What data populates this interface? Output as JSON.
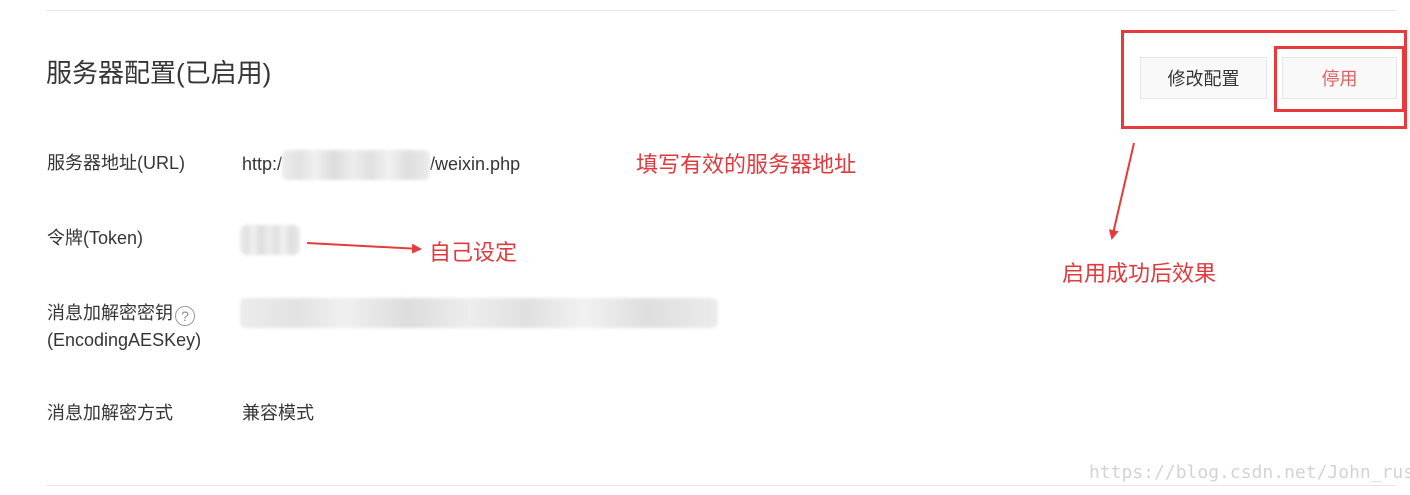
{
  "section": {
    "title": "服务器配置(已启用)"
  },
  "buttons": {
    "modify_label": "修改配置",
    "disable_label": "停用"
  },
  "fields": {
    "url": {
      "label": "服务器地址(URL)",
      "value_prefix": "http:/",
      "value_suffix": "/weixin.php"
    },
    "token": {
      "label": "令牌(Token)"
    },
    "aes_key": {
      "label_line1": "消息加解密密钥",
      "label_line2": "(EncodingAESKey)",
      "help_icon_glyph": "?"
    },
    "encrypt_mode": {
      "label": "消息加解密方式",
      "value": "兼容模式"
    }
  },
  "annotations": {
    "url_note": "填写有效的服务器地址",
    "token_note": "自己设定",
    "enabled_note": "启用成功后效果",
    "color": "#e8393c"
  },
  "watermark": "https://blog.csdn.net/John_rush",
  "icons": {
    "help": "question-circle-icon"
  }
}
